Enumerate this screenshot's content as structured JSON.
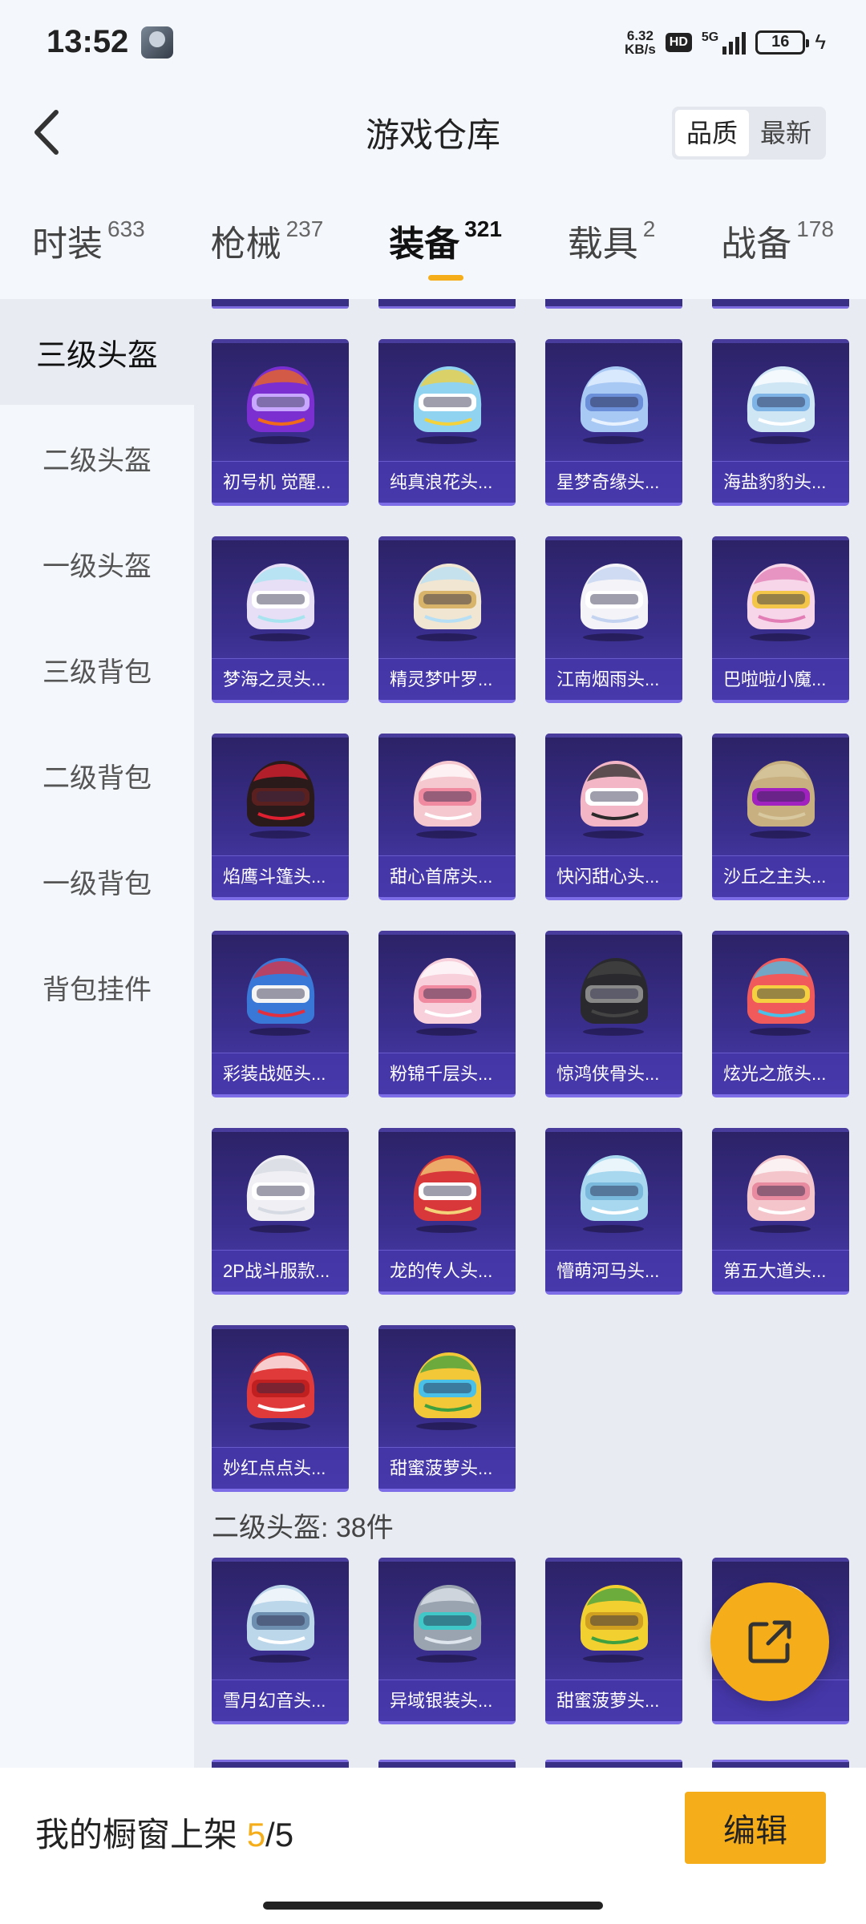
{
  "status_bar": {
    "time": "13:52",
    "net_speed_value": "6.32",
    "net_speed_unit": "KB/s",
    "hd": "HD",
    "signal": "5G",
    "battery": "16"
  },
  "header": {
    "title": "游戏仓库",
    "sort_options": [
      "品质",
      "最新"
    ],
    "active_sort": "品质"
  },
  "tabs": [
    {
      "label": "时装",
      "count": "633"
    },
    {
      "label": "枪械",
      "count": "237"
    },
    {
      "label": "装备",
      "count": "321"
    },
    {
      "label": "载具",
      "count": "2"
    },
    {
      "label": "战备",
      "count": "178"
    }
  ],
  "sidebar": {
    "items": [
      "三级头盔",
      "二级头盔",
      "一级头盔",
      "三级背包",
      "二级背包",
      "一级背包",
      "背包挂件"
    ]
  },
  "section_level3": {
    "items": [
      {
        "name": "初号机 觉醒...",
        "icon": "purple-mecha-helmet"
      },
      {
        "name": "纯真浪花头...",
        "icon": "blue-goggles-helmet"
      },
      {
        "name": "星梦奇缘头...",
        "icon": "crystal-helmet"
      },
      {
        "name": "海盐豹豹头...",
        "icon": "seal-helmet"
      },
      {
        "name": "梦海之灵头...",
        "icon": "pearl-helmet"
      },
      {
        "name": "精灵梦叶罗...",
        "icon": "winged-helmet"
      },
      {
        "name": "江南烟雨头...",
        "icon": "white-winged-helmet"
      },
      {
        "name": "巴啦啦小魔...",
        "icon": "magic-bow-helmet"
      },
      {
        "name": "焰鹰斗篷头...",
        "icon": "black-red-helmet"
      },
      {
        "name": "甜心首席头...",
        "icon": "pink-helmet"
      },
      {
        "name": "快闪甜心头...",
        "icon": "pink-black-helmet"
      },
      {
        "name": "沙丘之主头...",
        "icon": "sand-worm-helmet"
      },
      {
        "name": "彩装战姬头...",
        "icon": "color-armor-helmet"
      },
      {
        "name": "粉锦千层头...",
        "icon": "pink-layer-helmet"
      },
      {
        "name": "惊鸿侠骨头...",
        "icon": "dark-helmet"
      },
      {
        "name": "炫光之旅头...",
        "icon": "rainbow-helmet"
      },
      {
        "name": "2P战斗服款...",
        "icon": "white-helmet"
      },
      {
        "name": "龙的传人头...",
        "icon": "red-dragon-helmet"
      },
      {
        "name": "懵萌河马头...",
        "icon": "hippo-helmet"
      },
      {
        "name": "第五大道头...",
        "icon": "floral-helmet"
      },
      {
        "name": "妙红点点头...",
        "icon": "red-dot-helmet"
      },
      {
        "name": "甜蜜菠萝头...",
        "icon": "pineapple-helmet"
      }
    ]
  },
  "section_level2": {
    "title": "二级头盔: 38件",
    "items": [
      {
        "name": "雪月幻音头...",
        "icon": "snow-moon-helmet"
      },
      {
        "name": "异域银装头...",
        "icon": "silver-helmet"
      },
      {
        "name": "甜蜜菠萝头...",
        "icon": "yellow-pineapple-helmet"
      },
      {
        "name": "",
        "icon": "white-fluffy-helmet"
      }
    ]
  },
  "colors": {
    "accent": "#f5ae1a",
    "card_bg": "#3b2f8f",
    "card_border": "#7d6de6"
  },
  "bottom_bar": {
    "showcase_label": "我的橱窗上架",
    "current": "5",
    "separator": "/",
    "total": "5",
    "edit_label": "编辑"
  },
  "fab": {
    "icon": "share-icon"
  }
}
